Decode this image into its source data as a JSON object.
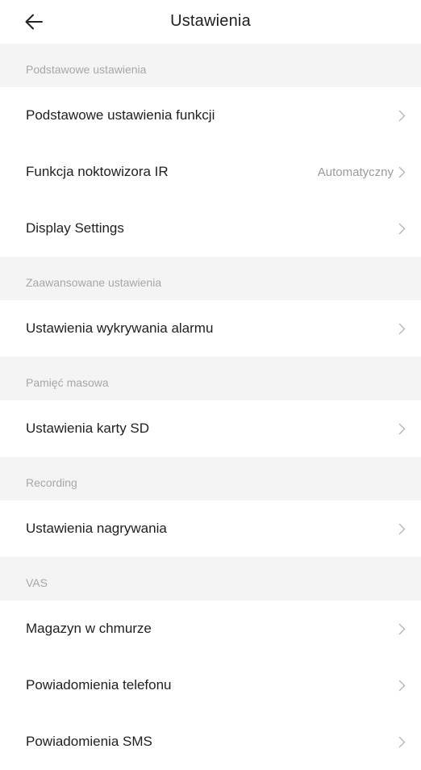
{
  "header": {
    "title": "Ustawienia",
    "back_icon": "arrow-left-icon"
  },
  "sections": [
    {
      "title": "Podstawowe ustawienia",
      "items": [
        {
          "label": "Podstawowe ustawienia funkcji",
          "value": ""
        },
        {
          "label": "Funkcja noktowizora IR",
          "value": "Automatyczny"
        },
        {
          "label": "Display Settings",
          "value": ""
        }
      ]
    },
    {
      "title": "Zaawansowane ustawienia",
      "items": [
        {
          "label": "Ustawienia wykrywania alarmu",
          "value": ""
        }
      ]
    },
    {
      "title": "Pamięć masowa",
      "items": [
        {
          "label": "Ustawienia karty SD",
          "value": ""
        }
      ]
    },
    {
      "title": "Recording",
      "items": [
        {
          "label": "Ustawienia nagrywania",
          "value": ""
        }
      ]
    },
    {
      "title": "VAS",
      "items": [
        {
          "label": "Magazyn w chmurze",
          "value": ""
        },
        {
          "label": "Powiadomienia telefonu",
          "value": ""
        },
        {
          "label": "Powiadomienia SMS",
          "value": ""
        }
      ]
    }
  ],
  "colors": {
    "section_background": "#f4f4f4",
    "section_text": "#a7a7a7",
    "item_text": "#1f1f1f",
    "value_text": "#9a9a9a",
    "chevron": "#b5b5b5"
  }
}
